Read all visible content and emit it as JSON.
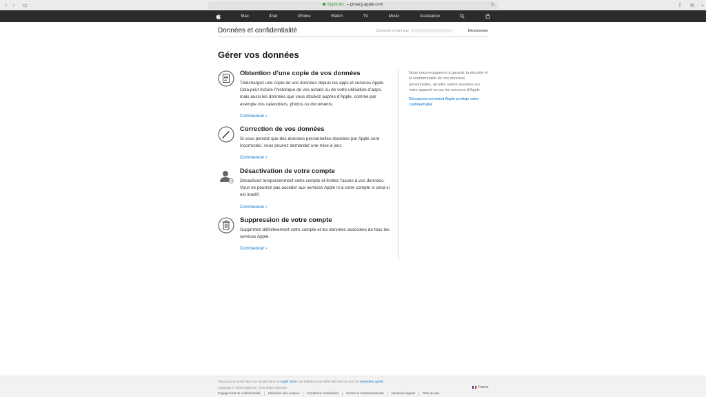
{
  "browser": {
    "url_owner": "Apple Inc.",
    "url_domain": "privacy.apple.com"
  },
  "gnav": {
    "items": [
      "Mac",
      "iPad",
      "iPhone",
      "Watch",
      "TV",
      "Music",
      "Assistance"
    ]
  },
  "localnav": {
    "title": "Données et confidentialité",
    "signed_in_label": "Connecté en tant que",
    "logout": "Déconnexion"
  },
  "page": {
    "title": "Gérer vos données"
  },
  "sections": [
    {
      "title": "Obtention d’une copie de vos données",
      "body": "Téléchargez une copie de vos données depuis les apps et services Apple. Cela peut inclure l’historique de vos achats ou de votre utilisation d’apps, mais aussi les données que vous stockez auprès d’Apple, comme par exemple vos calendriers, photos ou documents.",
      "link": "Commencer ›",
      "icon": "document-icon"
    },
    {
      "title": "Correction de vos données",
      "body": "Si vous pensez que des données personnelles stockées par Apple sont incorrectes, vous pouvez demander une mise à jour.",
      "link": "Commencer ›",
      "icon": "pencil-icon"
    },
    {
      "title": "Désactivation de votre compte",
      "body": "Désactivez temporairement votre compte et limitez l’accès à vos données. Vous ne pourrez pas accéder aux services Apple ni à votre compte si celui-ci est inactif.",
      "link": "Commencer ›",
      "icon": "user-deactivate-icon"
    },
    {
      "title": "Suppression de votre compte",
      "body": "Supprimez définitivement votre compte et les données associées de tous les services Apple.",
      "link": "Commencer ›",
      "icon": "trash-icon"
    }
  ],
  "aside": {
    "text": "Nous nous engageons à garantir la sécurité et la confidentialité de vos données personnelles, qu’elles soient stockées sur votre appareil ou sur les serveurs d’Apple.",
    "link": "Découvrez comment Apple protège votre confidentialité"
  },
  "footer": {
    "line1_prefix": "Vous pouvez aussi faire vos achats dans un",
    "apple_store": "Apple Store",
    "line1_mid": ", par téléphone au 0800 046 046 ou chez un",
    "reseller": "revendeur agréé",
    "copyright": "Copyright © 2018 Apple Inc. Tous droits réservés.",
    "links": [
      "Engagement de confidentialité",
      "Utilisation des cookies",
      "Conditions d’utilisation",
      "Ventes et remboursements",
      "Mentions légales",
      "Plan du site"
    ],
    "country": "France"
  }
}
